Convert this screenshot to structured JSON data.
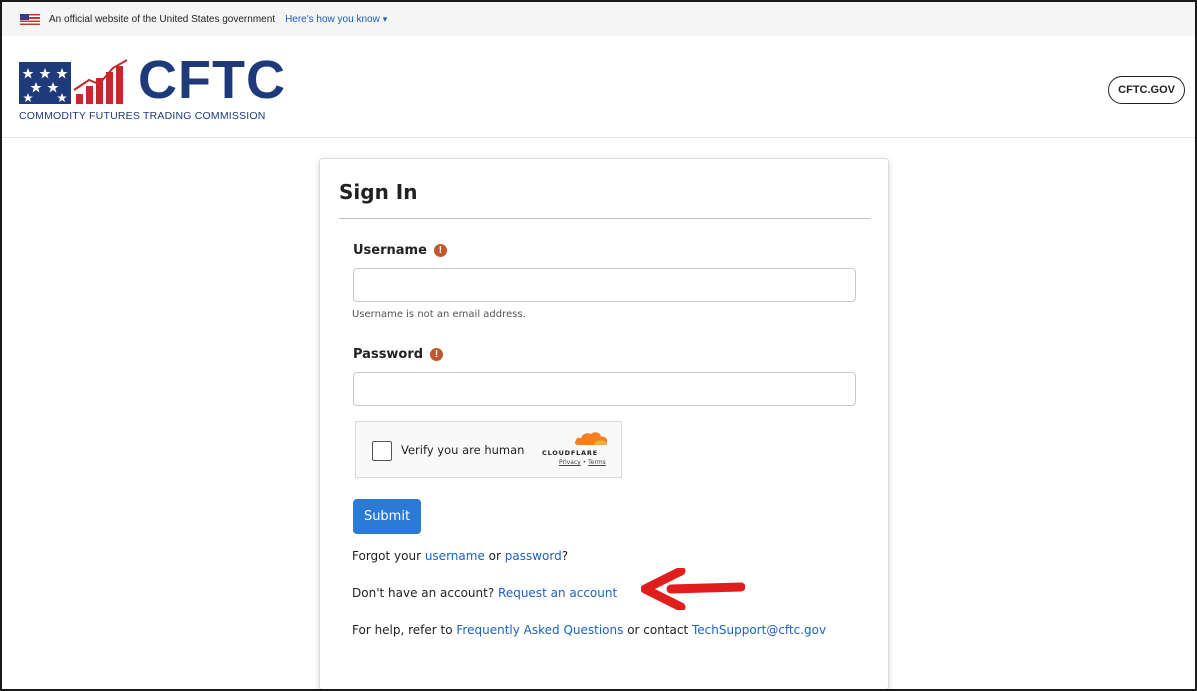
{
  "banner": {
    "text": "An official website of the United States government",
    "link": "Here's how you know"
  },
  "header": {
    "logo_text": "CFTC",
    "logo_subtitle": "COMMODITY FUTURES TRADING COMMISSION",
    "external_link": "CFTC.GOV"
  },
  "form": {
    "title": "Sign In",
    "username_label": "Username",
    "username_value": "",
    "username_help": "Username is not an email address.",
    "password_label": "Password",
    "password_value": "",
    "captcha": {
      "label": "Verify you are human",
      "brand": "CLOUDFLARE",
      "privacy": "Privacy",
      "separator": "•",
      "terms": "Terms"
    },
    "submit_label": "Submit",
    "forgot": {
      "prefix": "Forgot your ",
      "username_link": "username",
      "middle": " or ",
      "password_link": "password",
      "suffix": "?"
    },
    "request": {
      "prefix": "Don't have an account? ",
      "link": "Request an account"
    },
    "help": {
      "prefix": "For help, refer to ",
      "faq_link": "Frequently Asked Questions",
      "middle": " or contact ",
      "email_link": "TechSupport@cftc.gov"
    }
  },
  "colors": {
    "primary_button": "#2b7bd6",
    "link": "#1a62c2",
    "logo_blue": "#1f3a7a",
    "logo_red": "#c8252c",
    "info_icon": "#c0572e",
    "annotation_arrow": "#e01e1e"
  }
}
